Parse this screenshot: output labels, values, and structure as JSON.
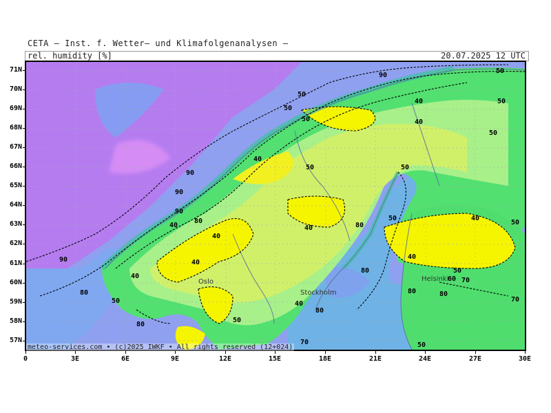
{
  "header": {
    "title": "CETA — Inst. f. Wetter— und Klimafolgenanalysen —",
    "variable": "rel. humidity [%]",
    "valid_time": "20.07.2025 12 UTC"
  },
  "footer": {
    "credit": "meteo-services.com • (c)2025 IWKF • All rights reserved (12+024)"
  },
  "axes": {
    "lat_labels": [
      "71N",
      "70N",
      "69N",
      "68N",
      "67N",
      "66N",
      "65N",
      "64N",
      "63N",
      "62N",
      "61N",
      "60N",
      "59N",
      "58N",
      "57N"
    ],
    "lon_labels": [
      "0",
      "3E",
      "6E",
      "9E",
      "12E",
      "15E",
      "18E",
      "21E",
      "24E",
      "27E",
      "30E"
    ]
  },
  "cities": [
    "Oslo",
    "Stockholm",
    "Helsinki"
  ],
  "contour_labels": [
    {
      "text": "90"
    },
    {
      "text": "90"
    },
    {
      "text": "90"
    },
    {
      "text": "90"
    },
    {
      "text": "90"
    },
    {
      "text": "40"
    },
    {
      "text": "40"
    },
    {
      "text": "40"
    },
    {
      "text": "40"
    },
    {
      "text": "40"
    },
    {
      "text": "40"
    },
    {
      "text": "40"
    },
    {
      "text": "40"
    },
    {
      "text": "40"
    },
    {
      "text": "40"
    },
    {
      "text": "40"
    },
    {
      "text": "50"
    },
    {
      "text": "50"
    },
    {
      "text": "50"
    },
    {
      "text": "50"
    },
    {
      "text": "50"
    },
    {
      "text": "50"
    },
    {
      "text": "50"
    },
    {
      "text": "50"
    },
    {
      "text": "50"
    },
    {
      "text": "50"
    },
    {
      "text": "50"
    },
    {
      "text": "50"
    },
    {
      "text": "50"
    },
    {
      "text": "50"
    },
    {
      "text": "60"
    },
    {
      "text": "70"
    },
    {
      "text": "70"
    },
    {
      "text": "70"
    },
    {
      "text": "80"
    },
    {
      "text": "80"
    },
    {
      "text": "80"
    },
    {
      "text": "80"
    },
    {
      "text": "80"
    },
    {
      "text": "80"
    },
    {
      "text": "80"
    },
    {
      "text": "80"
    }
  ],
  "colors": {
    "very_humid": "#c878f5",
    "humid": "#8fa0f0",
    "moist": "#78aaf5",
    "mid": "#6ec8c8",
    "green": "#4ee36b",
    "lightgreen": "#9ef08a",
    "yellowgreen": "#cdf06e",
    "dry": "#f5f500"
  }
}
